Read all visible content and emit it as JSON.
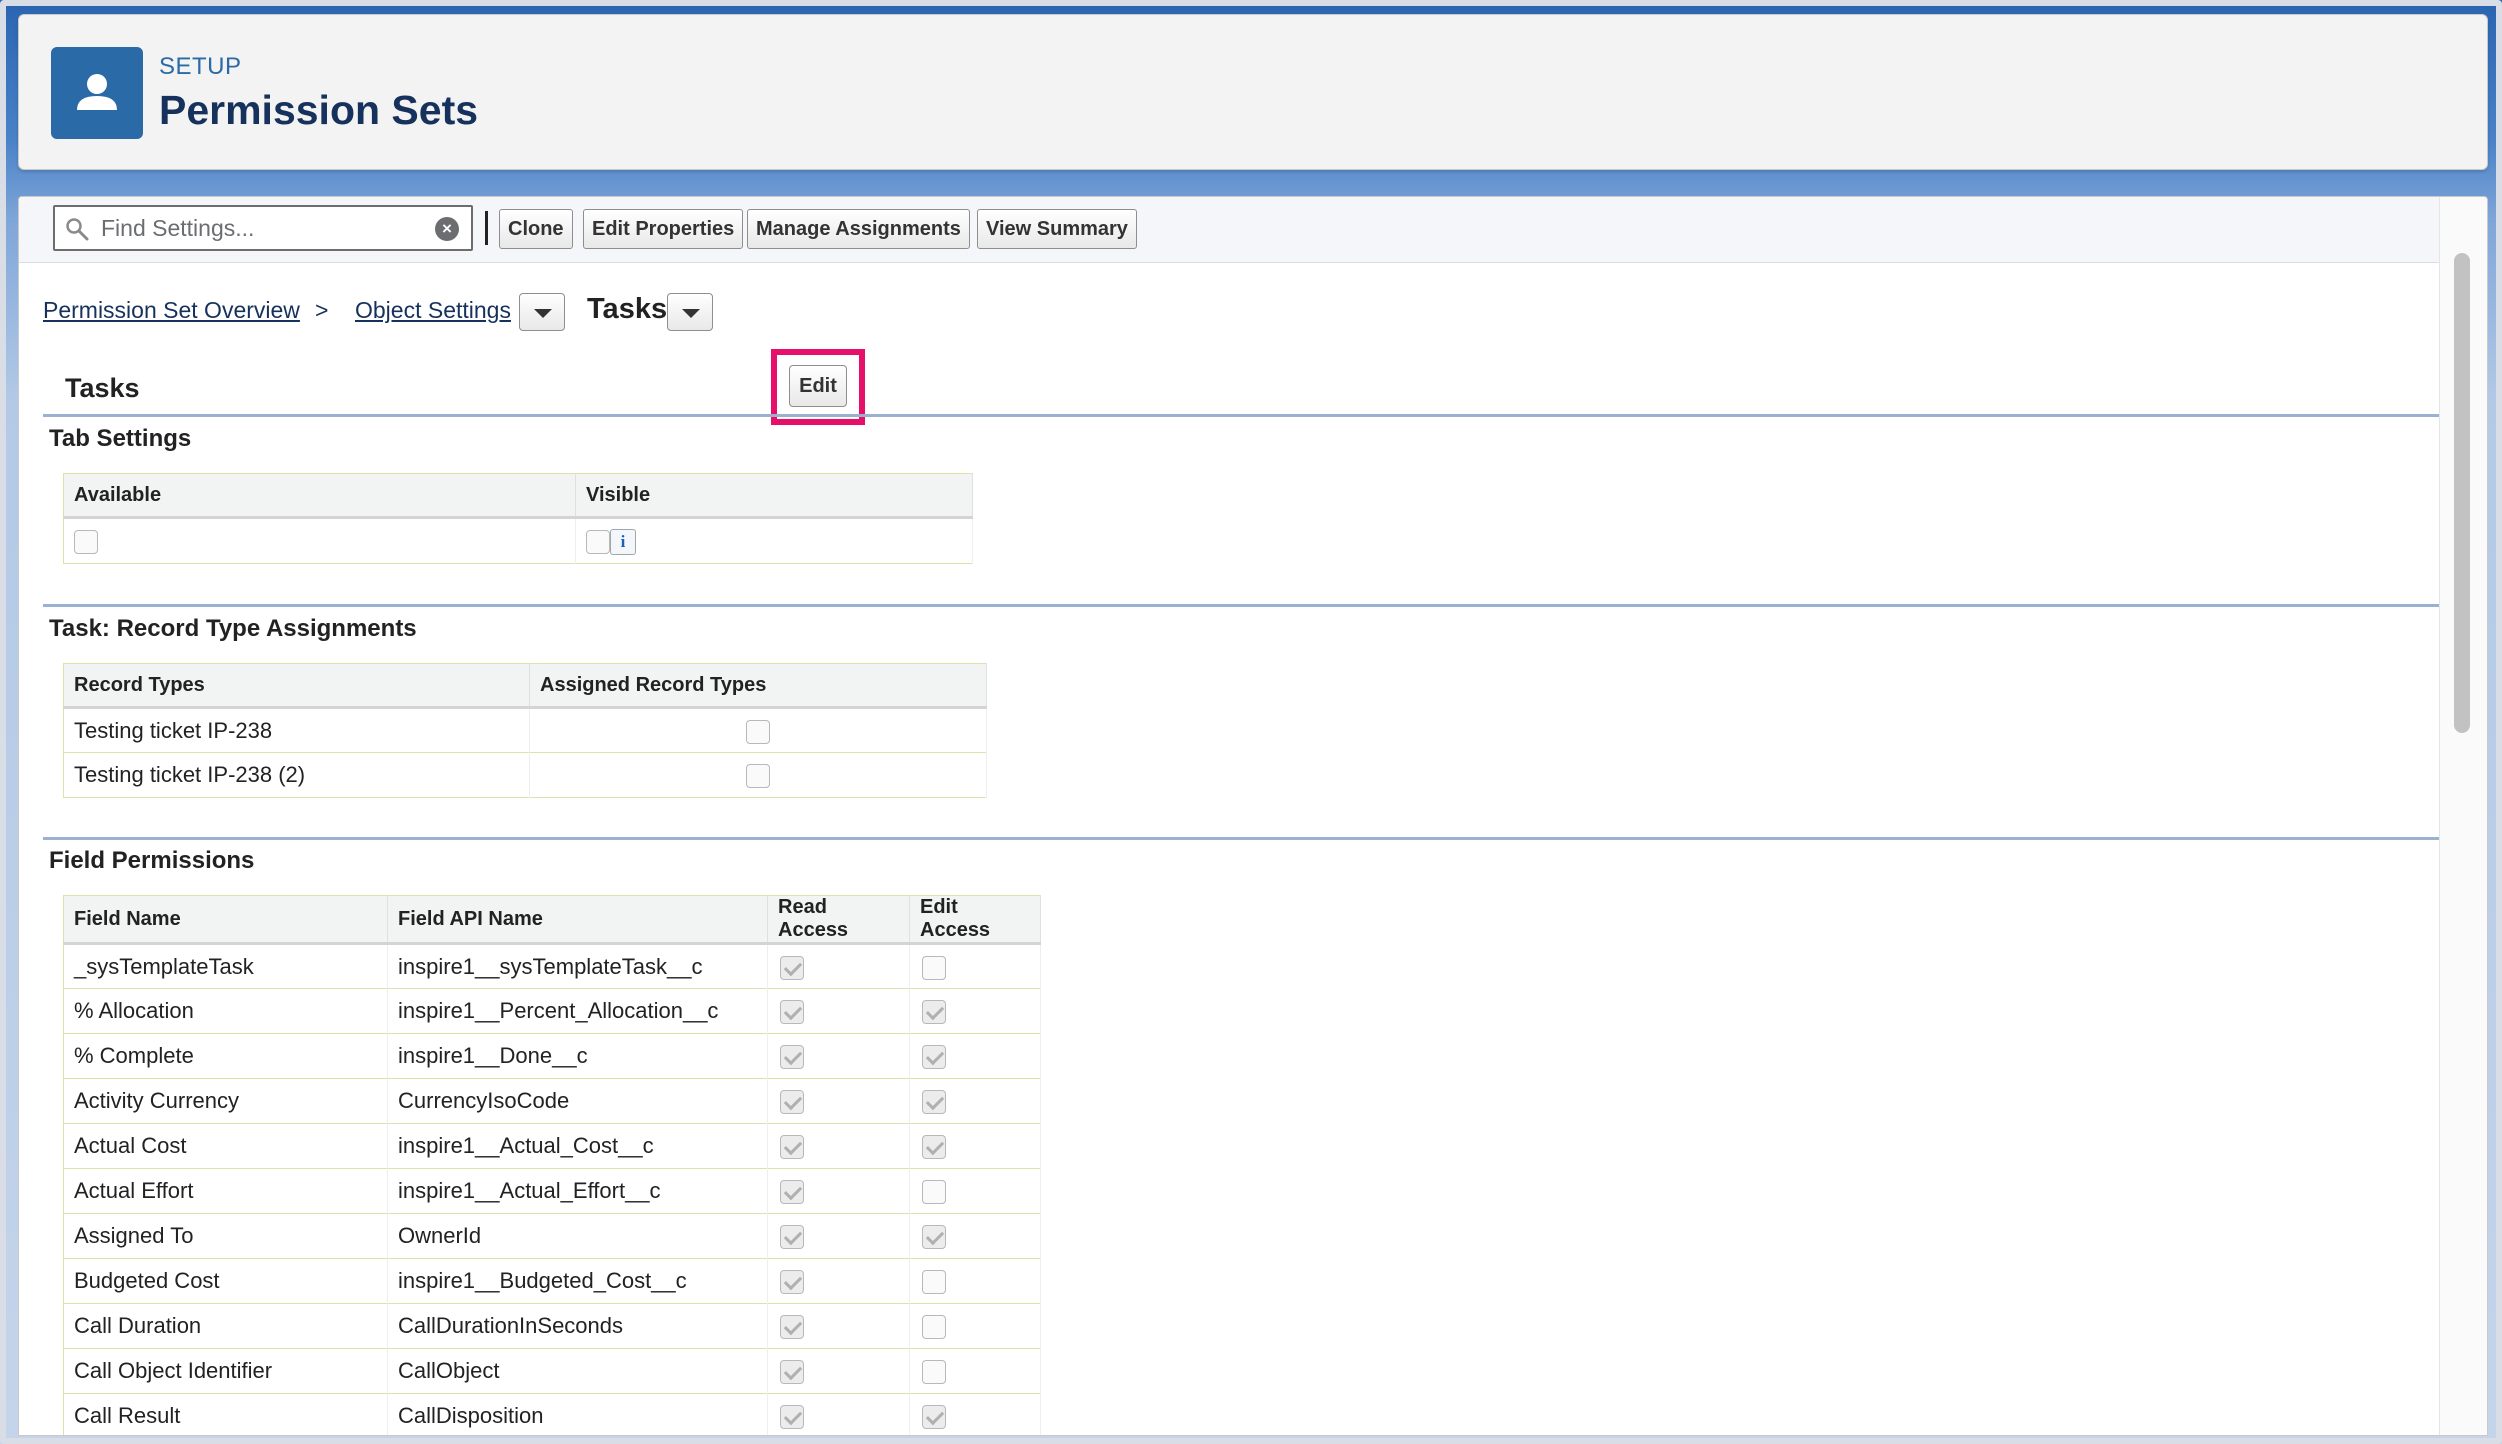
{
  "header": {
    "eyebrow": "SETUP",
    "title": "Permission Sets"
  },
  "toolbar": {
    "search_placeholder": "Find Settings...",
    "buttons": {
      "clone": "Clone",
      "edit_properties": "Edit Properties",
      "manage_assignments": "Manage Assignments",
      "view_summary": "View Summary"
    }
  },
  "breadcrumb": {
    "overview": "Permission Set Overview",
    "separator": ">",
    "object_settings": "Object Settings",
    "current": "Tasks"
  },
  "object": {
    "title": "Tasks",
    "edit_label": "Edit"
  },
  "tab_settings": {
    "title": "Tab Settings",
    "headers": {
      "available": "Available",
      "visible": "Visible"
    },
    "available_checked": false,
    "visible_checked": false,
    "info_glyph": "i"
  },
  "record_types": {
    "title": "Task: Record Type Assignments",
    "headers": {
      "record_types": "Record Types",
      "assigned": "Assigned Record Types"
    },
    "rows": [
      {
        "name": "Testing ticket IP-238",
        "assigned": false
      },
      {
        "name": "Testing ticket IP-238 (2)",
        "assigned": false
      }
    ]
  },
  "field_permissions": {
    "title": "Field Permissions",
    "headers": {
      "field_name": "Field Name",
      "api_name": "Field API Name",
      "read": "Read Access",
      "edit": "Edit Access"
    },
    "rows": [
      {
        "field": "_sysTemplateTask",
        "api": "inspire1__sysTemplateTask__c",
        "read": true,
        "edit": false
      },
      {
        "field": "% Allocation",
        "api": "inspire1__Percent_Allocation__c",
        "read": true,
        "edit": true
      },
      {
        "field": "% Complete",
        "api": "inspire1__Done__c",
        "read": true,
        "edit": true
      },
      {
        "field": "Activity Currency",
        "api": "CurrencyIsoCode",
        "read": true,
        "edit": true
      },
      {
        "field": "Actual Cost",
        "api": "inspire1__Actual_Cost__c",
        "read": true,
        "edit": true
      },
      {
        "field": "Actual Effort",
        "api": "inspire1__Actual_Effort__c",
        "read": true,
        "edit": false
      },
      {
        "field": "Assigned To",
        "api": "OwnerId",
        "read": true,
        "edit": true
      },
      {
        "field": "Budgeted Cost",
        "api": "inspire1__Budgeted_Cost__c",
        "read": true,
        "edit": false
      },
      {
        "field": "Call Duration",
        "api": "CallDurationInSeconds",
        "read": true,
        "edit": false
      },
      {
        "field": "Call Object Identifier",
        "api": "CallObject",
        "read": true,
        "edit": false
      },
      {
        "field": "Call Result",
        "api": "CallDisposition",
        "read": true,
        "edit": true
      }
    ]
  },
  "colors": {
    "highlight": "#e6106a",
    "brand": "#2a6aa6"
  },
  "icons": {
    "header": "user-icon",
    "search": "search-icon",
    "clear": "clear-icon",
    "dropdown": "chevron-down-icon"
  }
}
